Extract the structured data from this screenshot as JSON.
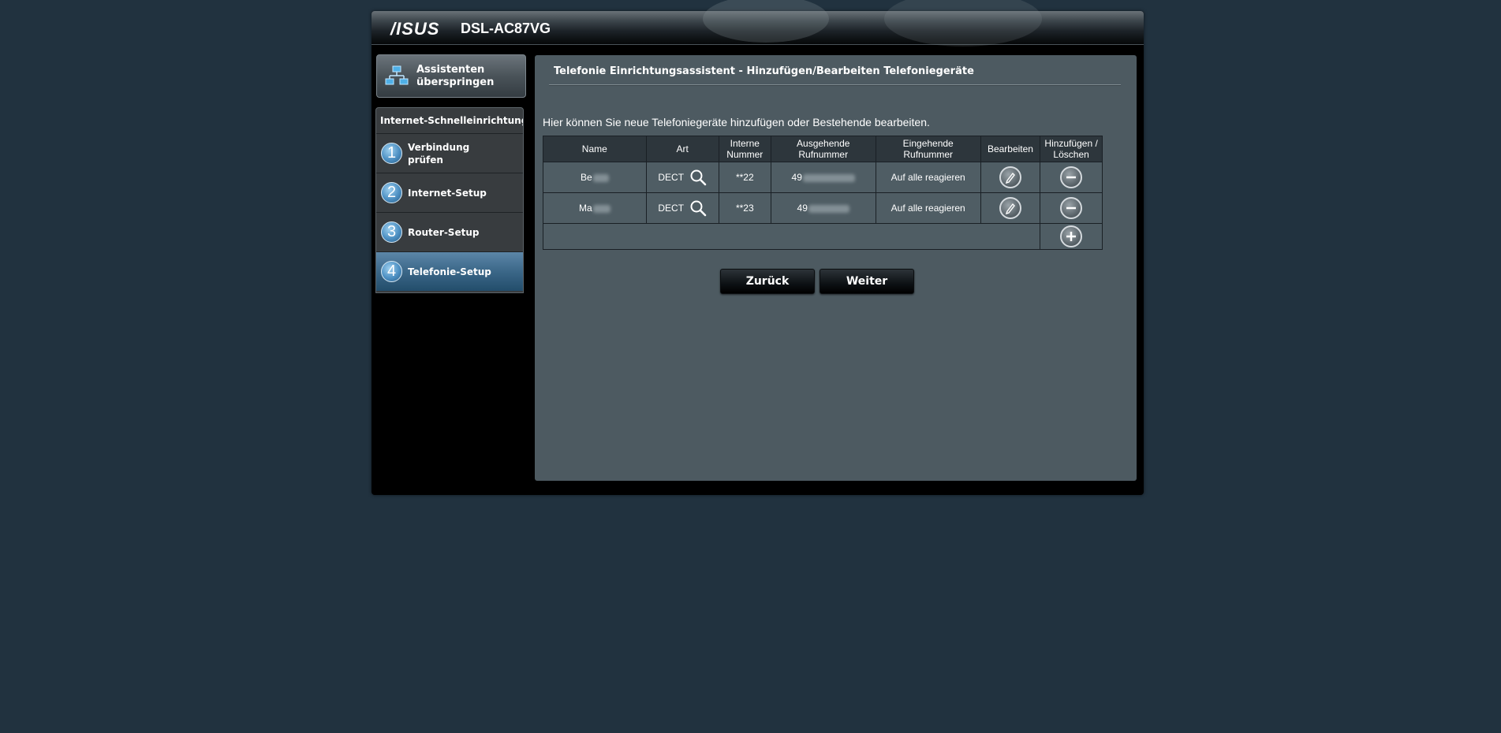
{
  "header": {
    "brand": "/ISUS",
    "model": "DSL-AC87VG"
  },
  "sidebar": {
    "skip_label": "Assistenten überspringen",
    "steps_title": "Internet-Schnelleinrichtung",
    "steps": [
      {
        "num": "1",
        "label": "Verbindung prüfen"
      },
      {
        "num": "2",
        "label": "Internet-Setup"
      },
      {
        "num": "3",
        "label": "Router-Setup"
      },
      {
        "num": "4",
        "label": "Telefonie-Setup"
      }
    ],
    "active_step": 4
  },
  "main": {
    "title": "Telefonie Einrichtungsassistent - Hinzufügen/Bearbeiten Telefoniegeräte",
    "description": "Hier können Sie neue Telefoniegeräte hinzufügen oder Bestehende bearbeiten.",
    "table": {
      "headers": {
        "name": "Name",
        "art": "Art",
        "interne": "Interne Nummer",
        "ausgehende": "Ausgehende Rufnummer",
        "eingehende": "Eingehende Rufnummer",
        "bearbeiten": "Bearbeiten",
        "hinzufuegen": "Hinzufügen / Löschen"
      },
      "rows": [
        {
          "name": "Be",
          "art": "DECT",
          "intern": "**22",
          "ausgehend": "49",
          "eingehend": "Auf alle reagieren"
        },
        {
          "name": "Ma",
          "art": "DECT",
          "intern": "**23",
          "ausgehend": "49",
          "eingehend": "Auf alle reagieren"
        }
      ]
    },
    "back_label": "Zurück",
    "next_label": "Weiter"
  },
  "icons": {
    "skip": "network-icon",
    "art": "search-icon",
    "edit": "pencil-icon",
    "delete": "minus-icon",
    "add": "plus-icon"
  }
}
